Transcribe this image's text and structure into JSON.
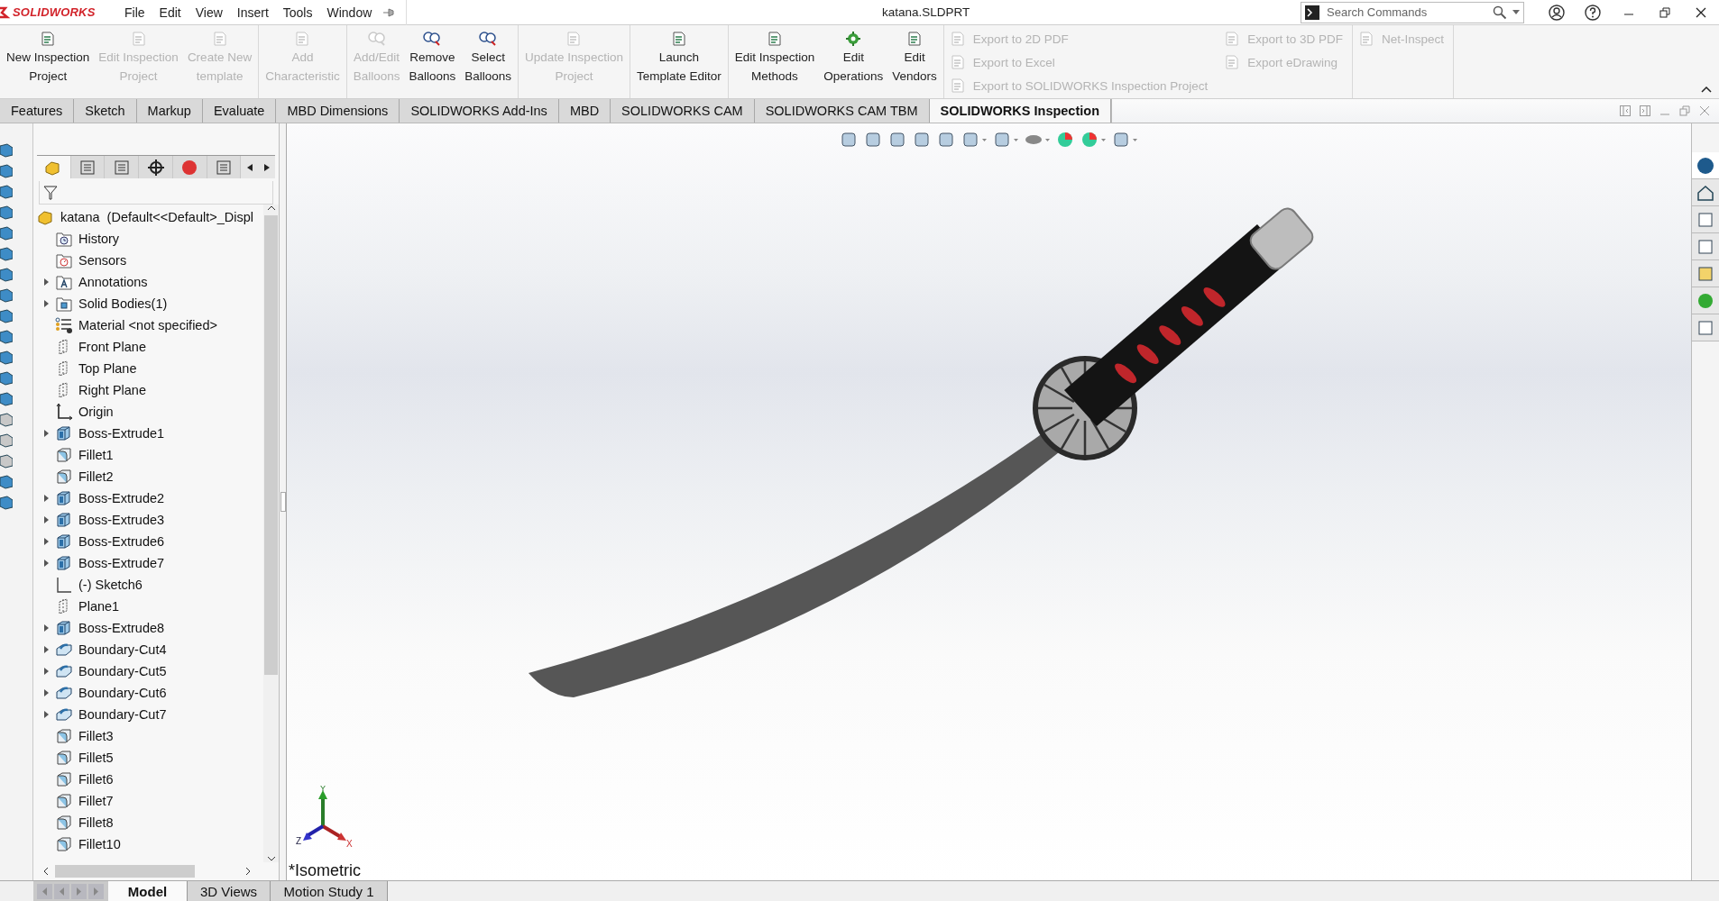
{
  "app": {
    "logo": "SOLIDWORKS"
  },
  "menu": [
    "File",
    "Edit",
    "View",
    "Insert",
    "Tools",
    "Window"
  ],
  "window": {
    "title": "katana.SLDPRT"
  },
  "search": {
    "placeholder": "Search Commands"
  },
  "ribbon": {
    "groups": [
      {
        "kind": "large",
        "buttons": [
          {
            "kind": "document",
            "lines": [
              "New Inspection",
              "Project"
            ],
            "disabled": false
          },
          {
            "kind": "document",
            "lines": [
              "Edit Inspection",
              "Project"
            ],
            "disabled": true
          },
          {
            "kind": "document",
            "lines": [
              "Create New",
              "template"
            ],
            "disabled": true
          }
        ]
      },
      {
        "kind": "large",
        "buttons": [
          {
            "kind": "document",
            "lines": [
              "Add",
              "Characteristic"
            ],
            "disabled": true
          }
        ]
      },
      {
        "kind": "large",
        "buttons": [
          {
            "kind": "balloon",
            "lines": [
              "Add/Edit",
              "Balloons"
            ],
            "disabled": true
          },
          {
            "kind": "balloon",
            "lines": [
              "Remove",
              "Balloons"
            ],
            "disabled": false
          },
          {
            "kind": "balloon",
            "lines": [
              "Select",
              "Balloons"
            ],
            "disabled": false
          }
        ]
      },
      {
        "kind": "large",
        "buttons": [
          {
            "kind": "document",
            "lines": [
              "Update Inspection",
              "Project"
            ],
            "disabled": true
          }
        ]
      },
      {
        "kind": "large",
        "buttons": [
          {
            "kind": "document",
            "lines": [
              "Launch",
              "Template Editor"
            ],
            "disabled": false
          }
        ]
      },
      {
        "kind": "large",
        "buttons": [
          {
            "kind": "document",
            "lines": [
              "Edit Inspection",
              "Methods"
            ],
            "disabled": false
          },
          {
            "kind": "gear",
            "lines": [
              "Edit",
              "Operations"
            ],
            "disabled": false
          },
          {
            "kind": "document",
            "lines": [
              "Edit",
              "Vendors"
            ],
            "disabled": false
          }
        ]
      },
      {
        "kind": "small",
        "columns": [
          [
            {
              "label": "Export to 2D PDF",
              "disabled": true
            },
            {
              "label": "Export to Excel",
              "disabled": true
            },
            {
              "label": "Export to SOLIDWORKS Inspection Project",
              "disabled": true
            }
          ],
          [
            {
              "label": "Export to 3D PDF",
              "disabled": true
            },
            {
              "label": "Export eDrawing",
              "disabled": true
            }
          ]
        ]
      },
      {
        "kind": "small",
        "columns": [
          [
            {
              "label": "Net-Inspect",
              "disabled": true
            }
          ]
        ]
      }
    ]
  },
  "tabs": [
    {
      "label": "Features",
      "selected": false
    },
    {
      "label": "Sketch",
      "selected": false
    },
    {
      "label": "Markup",
      "selected": false
    },
    {
      "label": "Evaluate",
      "selected": false
    },
    {
      "label": "MBD Dimensions",
      "selected": false
    },
    {
      "label": "SOLIDWORKS Add-Ins",
      "selected": false
    },
    {
      "label": "MBD",
      "selected": false
    },
    {
      "label": "SOLIDWORKS CAM",
      "selected": false
    },
    {
      "label": "SOLIDWORKS CAM TBM",
      "selected": false
    },
    {
      "label": "SOLIDWORKS Inspection",
      "selected": true
    }
  ],
  "tree": {
    "root": "katana  (Default<<Default>_Displ",
    "items": [
      {
        "label": "History",
        "kind": "history",
        "expandable": false
      },
      {
        "label": "Sensors",
        "kind": "sensors",
        "expandable": false
      },
      {
        "label": "Annotations",
        "kind": "annotations",
        "expandable": true
      },
      {
        "label": "Solid Bodies(1)",
        "kind": "bodies",
        "expandable": true
      },
      {
        "label": "Material <not specified>",
        "kind": "material",
        "expandable": false
      },
      {
        "label": "Front Plane",
        "kind": "plane",
        "expandable": false
      },
      {
        "label": "Top Plane",
        "kind": "plane",
        "expandable": false
      },
      {
        "label": "Right Plane",
        "kind": "plane",
        "expandable": false
      },
      {
        "label": "Origin",
        "kind": "origin",
        "expandable": false
      },
      {
        "label": "Boss-Extrude1",
        "kind": "extrude",
        "expandable": true
      },
      {
        "label": "Fillet1",
        "kind": "fillet",
        "expandable": false
      },
      {
        "label": "Fillet2",
        "kind": "fillet",
        "expandable": false
      },
      {
        "label": "Boss-Extrude2",
        "kind": "extrude",
        "expandable": true
      },
      {
        "label": "Boss-Extrude3",
        "kind": "extrude",
        "expandable": true
      },
      {
        "label": "Boss-Extrude6",
        "kind": "extrude",
        "expandable": true
      },
      {
        "label": "Boss-Extrude7",
        "kind": "extrude",
        "expandable": true
      },
      {
        "label": "(-) Sketch6",
        "kind": "sketch",
        "expandable": false
      },
      {
        "label": "Plane1",
        "kind": "plane",
        "expandable": false
      },
      {
        "label": "Boss-Extrude8",
        "kind": "extrude",
        "expandable": true
      },
      {
        "label": "Boundary-Cut4",
        "kind": "cut",
        "expandable": true
      },
      {
        "label": "Boundary-Cut5",
        "kind": "cut",
        "expandable": true
      },
      {
        "label": "Boundary-Cut6",
        "kind": "cut",
        "expandable": true
      },
      {
        "label": "Boundary-Cut7",
        "kind": "cut",
        "expandable": true
      },
      {
        "label": "Fillet3",
        "kind": "fillet",
        "expandable": false
      },
      {
        "label": "Fillet5",
        "kind": "fillet",
        "expandable": false
      },
      {
        "label": "Fillet6",
        "kind": "fillet",
        "expandable": false
      },
      {
        "label": "Fillet7",
        "kind": "fillet",
        "expandable": false
      },
      {
        "label": "Fillet8",
        "kind": "fillet",
        "expandable": false
      },
      {
        "label": "Fillet10",
        "kind": "fillet",
        "expandable": false
      }
    ]
  },
  "view": {
    "name": "*Isometric",
    "triad": {
      "x": "X",
      "y": "Y",
      "z": "Z"
    }
  },
  "bottom_tabs": [
    {
      "label": "Model",
      "selected": true
    },
    {
      "label": "3D Views",
      "selected": false
    },
    {
      "label": "Motion Study 1",
      "selected": false
    }
  ]
}
